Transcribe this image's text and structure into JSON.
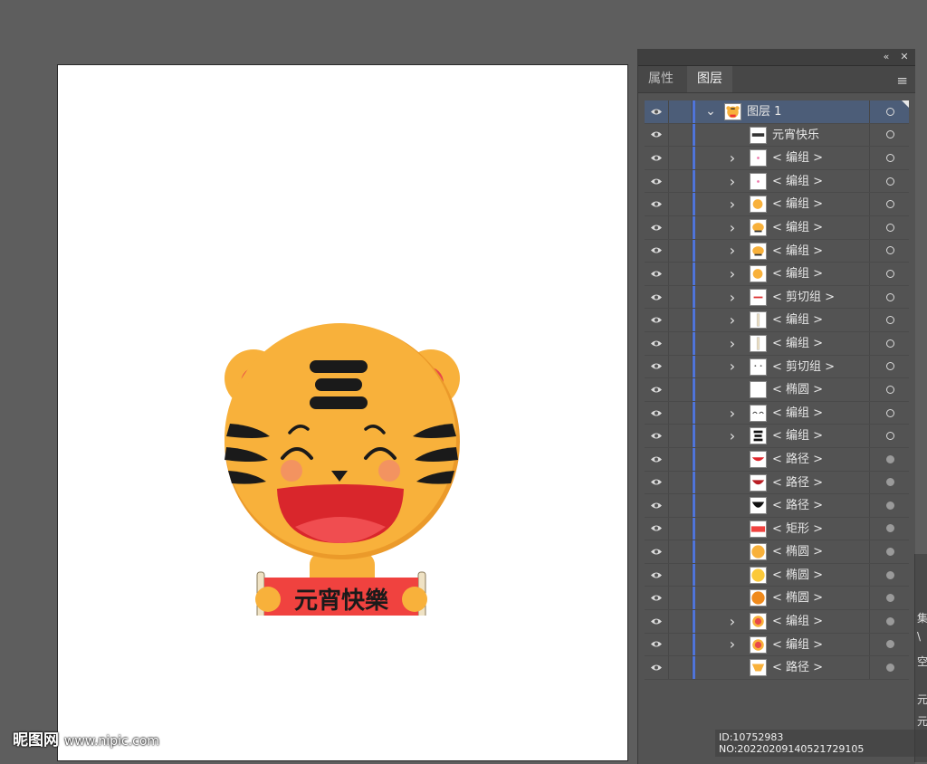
{
  "panel": {
    "tabs": [
      {
        "label": "属性",
        "active": false
      },
      {
        "label": "图层",
        "active": true
      }
    ],
    "collapse_icon": "double-chevron-left-icon",
    "close_icon": "close-icon",
    "menu_icon": "hamburger-menu-icon"
  },
  "layers": [
    {
      "name": "图层  1",
      "level": 0,
      "expander": "expanded",
      "selected": true,
      "target": "hollow",
      "thumb": "tiger"
    },
    {
      "name": "元宵快乐",
      "level": 1,
      "expander": "none",
      "target": "hollow",
      "thumb": "text"
    },
    {
      "name": "< 编组 >",
      "level": 1,
      "expander": "collapsed",
      "target": "hollow",
      "thumb": "dot"
    },
    {
      "name": "< 编组 >",
      "level": 1,
      "expander": "collapsed",
      "target": "hollow",
      "thumb": "dot"
    },
    {
      "name": "< 编组 >",
      "level": 1,
      "expander": "collapsed",
      "target": "hollow",
      "thumb": "hand"
    },
    {
      "name": "< 编组 >",
      "level": 1,
      "expander": "collapsed",
      "target": "hollow",
      "thumb": "paw"
    },
    {
      "name": "< 编组 >",
      "level": 1,
      "expander": "collapsed",
      "target": "hollow",
      "thumb": "paw"
    },
    {
      "name": "< 编组 >",
      "level": 1,
      "expander": "collapsed",
      "target": "hollow",
      "thumb": "hand"
    },
    {
      "name": "< 剪切组 >",
      "level": 1,
      "expander": "collapsed",
      "target": "hollow",
      "thumb": "mouthline"
    },
    {
      "name": "< 编组 >",
      "level": 1,
      "expander": "collapsed",
      "target": "hollow",
      "thumb": "scroll"
    },
    {
      "name": "< 编组 >",
      "level": 1,
      "expander": "collapsed",
      "target": "hollow",
      "thumb": "scroll"
    },
    {
      "name": "< 剪切组 >",
      "level": 1,
      "expander": "collapsed",
      "target": "hollow",
      "thumb": "dots"
    },
    {
      "name": "< 椭圆 >",
      "level": 1,
      "expander": "none",
      "target": "hollow",
      "thumb": "blank"
    },
    {
      "name": "< 编组 >",
      "level": 1,
      "expander": "collapsed",
      "target": "hollow",
      "thumb": "eyes"
    },
    {
      "name": "< 编组 >",
      "level": 1,
      "expander": "collapsed",
      "target": "hollow",
      "thumb": "stripes"
    },
    {
      "name": "< 路径 >",
      "level": 1,
      "expander": "none",
      "target": "filled",
      "thumb": "redmouth"
    },
    {
      "name": "< 路径 >",
      "level": 1,
      "expander": "none",
      "target": "filled",
      "thumb": "redmouth2"
    },
    {
      "name": "< 路径 >",
      "level": 1,
      "expander": "none",
      "target": "filled",
      "thumb": "blackmouth"
    },
    {
      "name": "< 矩形 >",
      "level": 1,
      "expander": "none",
      "target": "filled",
      "thumb": "redrect"
    },
    {
      "name": "< 椭圆 >",
      "level": 1,
      "expander": "none",
      "target": "filled",
      "thumb": "orangecircle"
    },
    {
      "name": "< 椭圆 >",
      "level": 1,
      "expander": "none",
      "target": "filled",
      "thumb": "yellowcircle"
    },
    {
      "name": "< 椭圆 >",
      "level": 1,
      "expander": "none",
      "target": "filled",
      "thumb": "darkorangecircle"
    },
    {
      "name": "< 编组 >",
      "level": 1,
      "expander": "collapsed",
      "target": "filled",
      "thumb": "ears"
    },
    {
      "name": "< 编组 >",
      "level": 1,
      "expander": "collapsed",
      "target": "filled",
      "thumb": "ears"
    },
    {
      "name": "< 路径 >",
      "level": 1,
      "expander": "none",
      "target": "filled",
      "thumb": "shield"
    }
  ],
  "artboard": {
    "banner_text": "元宵快樂"
  },
  "side_panel_fragment": [
    "集",
    "\\",
    "空",
    "元",
    "元"
  ],
  "watermark": {
    "left": "昵图网",
    "left_url": "www.nipic.com",
    "right": "ID:10752983 NO:20220209140521729105"
  },
  "colors": {
    "tiger_orange": "#f8b13b",
    "banner_red": "#f0423f",
    "layer_color_bar": "#4f74d9",
    "selected_row": "#4c5d78"
  }
}
